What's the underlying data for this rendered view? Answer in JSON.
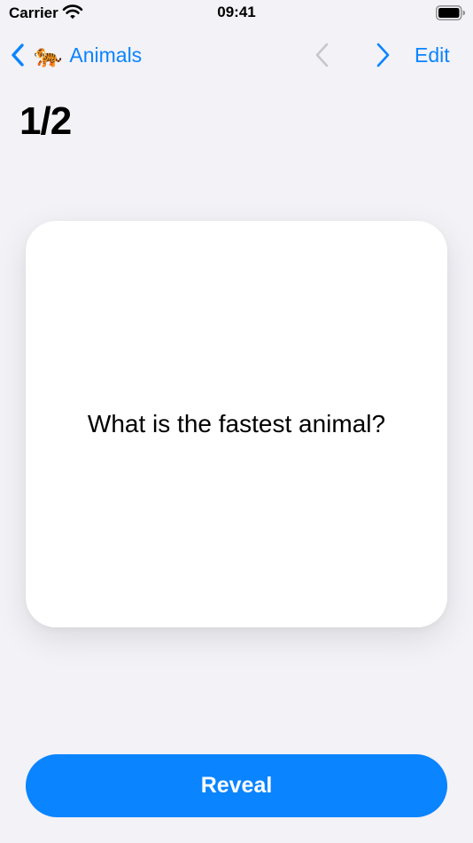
{
  "status_bar": {
    "carrier": "Carrier",
    "time": "09:41",
    "wifi_icon": "wifi-icon",
    "battery_icon": "battery-full-icon"
  },
  "nav": {
    "back_label": "Animals",
    "back_emoji": "🐅",
    "back_icon": "chevron-left-icon",
    "prev_icon": "chevron-left-icon",
    "prev_enabled": false,
    "next_icon": "chevron-right-icon",
    "next_enabled": true,
    "edit_label": "Edit"
  },
  "page": {
    "title": "1/2"
  },
  "card": {
    "question": "What is the fastest animal?"
  },
  "actions": {
    "reveal_label": "Reveal"
  },
  "colors": {
    "accent": "#0A84FF",
    "background": "#F2F2F7",
    "card": "#FFFFFF",
    "disabled": "#C7C7CC"
  }
}
